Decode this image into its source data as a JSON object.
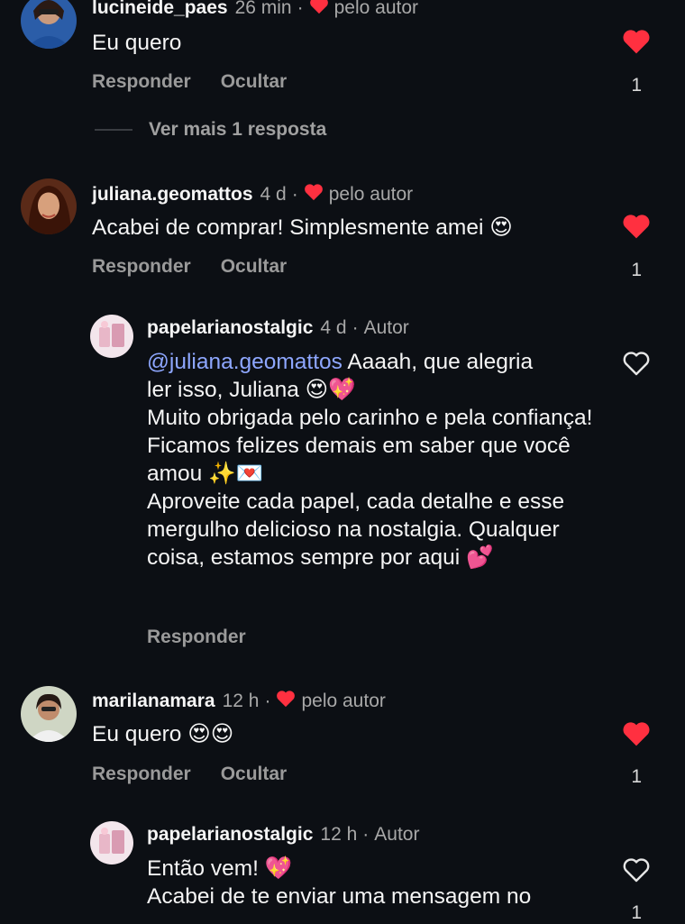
{
  "ui": {
    "reply_label": "Responder",
    "hide_label": "Ocultar",
    "liked_by_author": "pelo autor",
    "author_badge": "Autor",
    "colors": {
      "background": "#0c0f14",
      "heart_red": "#ff3040",
      "mention": "#8ea7ff",
      "muted": "#a8a8a8"
    }
  },
  "comments": [
    {
      "username": "lucineide_paes",
      "time": "26 min",
      "text": "Eu quero",
      "like_count": "1",
      "liked": true,
      "view_more": "Ver mais 1 resposta"
    },
    {
      "username": "juliana.geomattos",
      "time": "4 d",
      "text": "Acabei de comprar! Simplesmente amei 😍",
      "like_count": "1",
      "liked": true,
      "reply": {
        "username": "papelarianostalgic",
        "time": "4 d",
        "mention": "@juliana.geomattos",
        "line1_rest": " Aaaah, que alegria",
        "line2": "ler isso, Juliana 😍💖",
        "para2": "Muito obrigada pelo carinho e pela confiança! Ficamos felizes demais em saber que você amou ✨💌",
        "para3": "Aproveite cada papel, cada detalhe e esse mergulho delicioso na nostalgia. Qualquer coisa, estamos sempre por aqui 💕"
      }
    },
    {
      "username": "marilanamara",
      "time": "12 h",
      "text": "Eu quero 😍😍",
      "like_count": "1",
      "liked": true,
      "reply": {
        "username": "papelarianostalgic",
        "time": "12 h",
        "line1": "Então vem! 💖",
        "line2": "Acabei de te enviar uma mensagem no",
        "like_count": "1"
      }
    }
  ]
}
